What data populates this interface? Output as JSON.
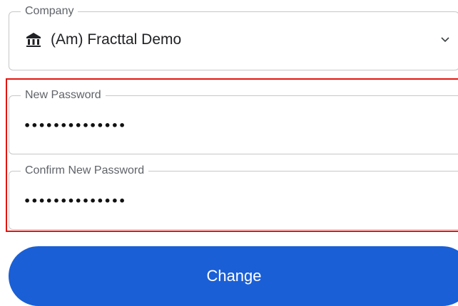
{
  "company": {
    "label": "Company",
    "value": "(Am) Fracttal Demo",
    "icon": "bank-icon"
  },
  "new_password": {
    "label": "New Password",
    "value": "••••••••••••••"
  },
  "confirm_password": {
    "label": "Confirm New Password",
    "value": "••••••••••••••"
  },
  "change_button": {
    "label": "Change"
  },
  "colors": {
    "highlight": "#e3140f",
    "button": "#1a5fd6"
  }
}
